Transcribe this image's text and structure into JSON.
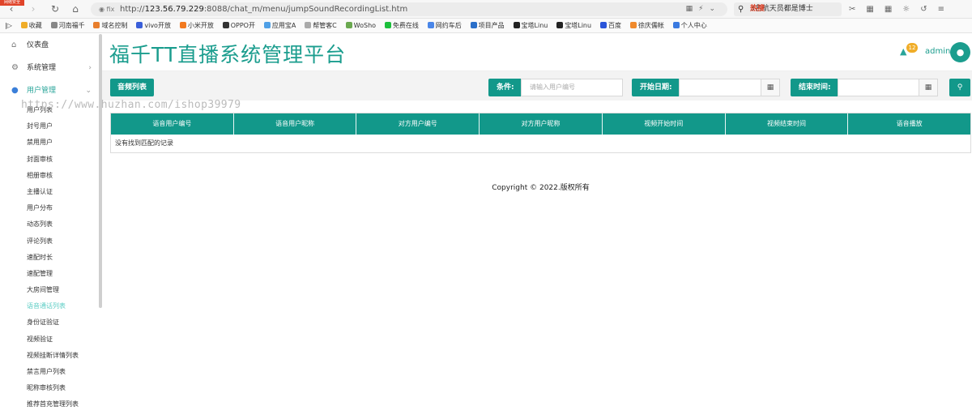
{
  "browser": {
    "corner_badge": "网络安全",
    "url_prefix": "http://",
    "url_host": "123.56.79.229",
    "url_path": ":8088/chat_m/menu/jumpSoundRecordingList.htm",
    "search_text": "3名航天员都是博士",
    "search_hot": "热搜",
    "bookmarks": [
      "收藏",
      "河南福千",
      "域名控制",
      "vivo开放",
      "小米开放",
      "OPPO开",
      "应用宝A",
      "帮管客C",
      "WoSho",
      "免费在线",
      "网约车后",
      "项目产品",
      "宝塔Linu",
      "宝塔Linu",
      "百度",
      "徐庆儒帐",
      "个人中心"
    ]
  },
  "sidebar": {
    "top_items": [
      {
        "label": "仪表盘",
        "icon": "home-icon"
      },
      {
        "label": "系统管理",
        "icon": "cogs-icon"
      },
      {
        "label": "用户管理",
        "icon": "user-icon"
      }
    ],
    "sub_items": [
      "用户列表",
      "封号用户",
      "禁用用户",
      "封面审核",
      "相册审核",
      "主播认证",
      "用户分布",
      "动态列表",
      "评论列表",
      "速配时长",
      "速配管理",
      "大房间管理",
      "语音通话列表",
      "身份证验证",
      "视频验证",
      "视频挂断详情列表",
      "禁言用户列表",
      "昵称审核列表",
      "推荐首充管理列表"
    ],
    "active_sub_index": 12
  },
  "watermark": "https://www.huzhan.com/ishop39979",
  "header": {
    "brand": "福千TT直播系统管理平台",
    "notification_count": "12",
    "user": "admin"
  },
  "toolbar": {
    "audio_list_btn": "音频列表",
    "condition_label": "条件:",
    "condition_placeholder": "请输入用户编号",
    "start_label": "开始日期:",
    "end_label": "结束时间:"
  },
  "table": {
    "columns": [
      "语音用户编号",
      "语音用户昵称",
      "对方用户编号",
      "对方用户昵称",
      "视频开始时间",
      "视频结束时间",
      "语音播放"
    ],
    "empty_text": "没有找到匹配的记录"
  },
  "footer": "Copyright © 2022.版权所有",
  "colors": {
    "accent": "#12988a",
    "brand": "#1b9d8e",
    "badge": "#f0ad28"
  }
}
